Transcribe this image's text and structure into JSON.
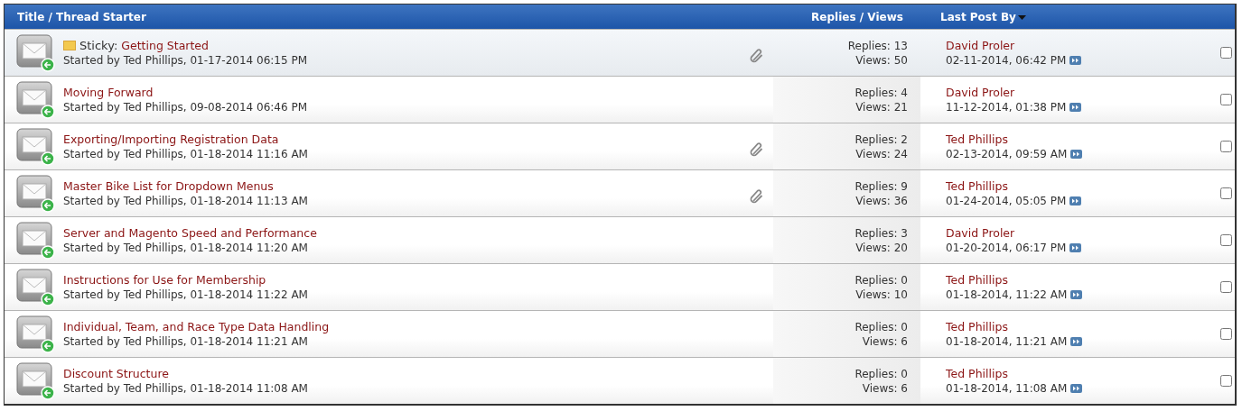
{
  "header": {
    "title_col": "Title / Thread Starter",
    "stats_col": "Replies / Views",
    "last_col": "Last Post By"
  },
  "threads": [
    {
      "sticky": true,
      "prefix": "Sticky:",
      "title": "Getting Started",
      "starter": "Started by Ted Phillips, 01-17-2014 06:15 PM",
      "attachment": true,
      "replies": "Replies: 13",
      "views": "Views: 50",
      "last_by": "David Proler",
      "last_time": "02-11-2014, 06:42 PM",
      "checked": false
    },
    {
      "sticky": false,
      "title": "Moving Forward",
      "starter": "Started by Ted Phillips, 09-08-2014 06:46 PM",
      "attachment": false,
      "replies": "Replies: 4",
      "views": "Views: 21",
      "last_by": "David Proler",
      "last_time": "11-12-2014, 01:38 PM",
      "checked": false
    },
    {
      "sticky": false,
      "title": "Exporting/Importing Registration Data",
      "starter": "Started by Ted Phillips, 01-18-2014 11:16 AM",
      "attachment": true,
      "replies": "Replies: 2",
      "views": "Views: 24",
      "last_by": "Ted Phillips",
      "last_time": "02-13-2014, 09:59 AM",
      "checked": false
    },
    {
      "sticky": false,
      "title": "Master Bike List for Dropdown Menus",
      "starter": "Started by Ted Phillips, 01-18-2014 11:13 AM",
      "attachment": true,
      "replies": "Replies: 9",
      "views": "Views: 36",
      "last_by": "Ted Phillips",
      "last_time": "01-24-2014, 05:05 PM",
      "checked": false
    },
    {
      "sticky": false,
      "title": "Server and Magento Speed and Performance",
      "starter": "Started by Ted Phillips, 01-18-2014 11:20 AM",
      "attachment": false,
      "replies": "Replies: 3",
      "views": "Views: 20",
      "last_by": "David Proler",
      "last_time": "01-20-2014, 06:17 PM",
      "checked": false
    },
    {
      "sticky": false,
      "title": "Instructions for Use for Membership",
      "starter": "Started by Ted Phillips, 01-18-2014 11:22 AM",
      "attachment": false,
      "replies": "Replies: 0",
      "views": "Views: 10",
      "last_by": "Ted Phillips",
      "last_time": "01-18-2014, 11:22 AM",
      "checked": false
    },
    {
      "sticky": false,
      "title": "Individual, Team, and Race Type Data Handling",
      "starter": "Started by Ted Phillips, 01-18-2014 11:21 AM",
      "attachment": false,
      "replies": "Replies: 0",
      "views": "Views: 6",
      "last_by": "Ted Phillips",
      "last_time": "01-18-2014, 11:21 AM",
      "checked": false
    },
    {
      "sticky": false,
      "title": "Discount Structure",
      "starter": "Started by Ted Phillips, 01-18-2014 11:08 AM",
      "attachment": false,
      "replies": "Replies: 0",
      "views": "Views: 6",
      "last_by": "Ted Phillips",
      "last_time": "01-18-2014, 11:08 AM",
      "checked": false
    }
  ]
}
